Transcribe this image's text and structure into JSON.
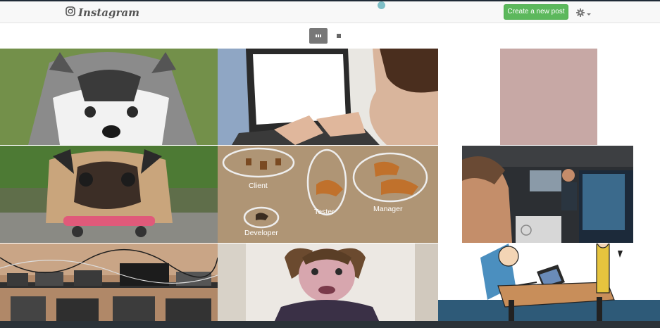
{
  "navbar": {
    "brand_name": "Instagram",
    "brand_icon": "instagram-icon",
    "create_button_label": "Create a new post",
    "settings_icon": "gear-icon"
  },
  "view_toggle": {
    "grid_icon": "grid-view-icon",
    "single_icon": "single-view-icon",
    "active": "grid"
  },
  "feed": {
    "posts": [
      {
        "id": 1,
        "subject": "husky puppy"
      },
      {
        "id": 2,
        "subject": "woman on laptop"
      },
      {
        "id": 3,
        "subject": "pink wall"
      },
      {
        "id": 4,
        "subject": "pug on skateboard"
      },
      {
        "id": 5,
        "subject": "tigers",
        "labels": [
          "Client",
          "Tester",
          "Manager",
          "Developer"
        ]
      },
      {
        "id": 6,
        "subject": "office"
      },
      {
        "id": 7,
        "subject": "devices charging"
      },
      {
        "id": 8,
        "subject": "girl funny face"
      },
      {
        "id": 9,
        "subject": "cartoon office"
      }
    ]
  },
  "colors": {
    "accent_green": "#5cb85c",
    "navbar_bg": "#f8f8f8",
    "footer_bg": "#2b3238"
  }
}
